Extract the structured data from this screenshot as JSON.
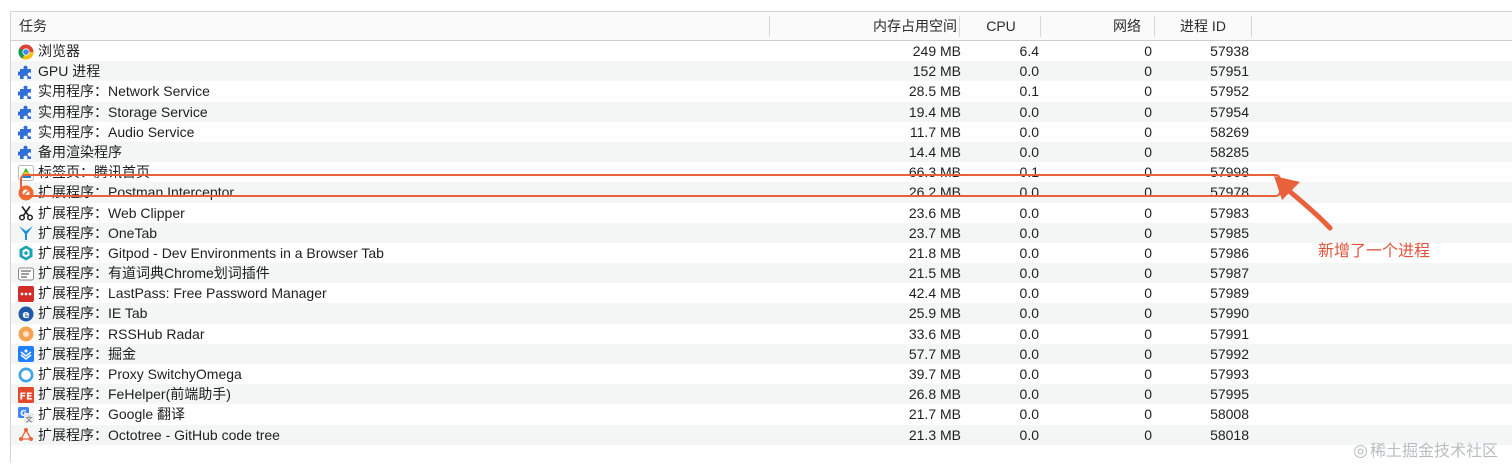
{
  "header": {
    "task": "任务",
    "memory": "内存占用空间",
    "cpu": "CPU",
    "network": "网络",
    "pid": "进程 ID"
  },
  "rows": [
    {
      "name": "浏览器",
      "mem": "249 MB",
      "cpu": "6.4",
      "net": "0",
      "pid": "57938",
      "icon": "chrome-icon"
    },
    {
      "name": "GPU 进程",
      "mem": "152 MB",
      "cpu": "0.0",
      "net": "0",
      "pid": "57951",
      "icon": "puzzle-icon"
    },
    {
      "name": "实用程序：Network Service",
      "mem": "28.5 MB",
      "cpu": "0.1",
      "net": "0",
      "pid": "57952",
      "icon": "puzzle-icon"
    },
    {
      "name": "实用程序：Storage Service",
      "mem": "19.4 MB",
      "cpu": "0.0",
      "net": "0",
      "pid": "57954",
      "icon": "puzzle-icon"
    },
    {
      "name": "实用程序：Audio Service",
      "mem": "11.7 MB",
      "cpu": "0.0",
      "net": "0",
      "pid": "58269",
      "icon": "puzzle-icon"
    },
    {
      "name": "备用渲染程序",
      "mem": "14.4 MB",
      "cpu": "0.0",
      "net": "0",
      "pid": "58285",
      "icon": "puzzle-icon"
    },
    {
      "name": "标签页：腾讯首页",
      "mem": "66.3 MB",
      "cpu": "0.1",
      "net": "0",
      "pid": "57998",
      "icon": "qq-tab-icon"
    },
    {
      "name": "扩展程序：Postman Interceptor",
      "mem": "26.2 MB",
      "cpu": "0.0",
      "net": "0",
      "pid": "57978",
      "icon": "postman-icon"
    },
    {
      "name": "扩展程序：Web Clipper",
      "mem": "23.6 MB",
      "cpu": "0.0",
      "net": "0",
      "pid": "57983",
      "icon": "scissors-icon"
    },
    {
      "name": "扩展程序：OneTab",
      "mem": "23.7 MB",
      "cpu": "0.0",
      "net": "0",
      "pid": "57985",
      "icon": "funnel-icon"
    },
    {
      "name": "扩展程序：Gitpod - Dev Environments in a Browser Tab",
      "mem": "21.8 MB",
      "cpu": "0.0",
      "net": "0",
      "pid": "57986",
      "icon": "gitpod-icon"
    },
    {
      "name": "扩展程序：有道词典Chrome划词插件",
      "mem": "21.5 MB",
      "cpu": "0.0",
      "net": "0",
      "pid": "57987",
      "icon": "youdao-icon"
    },
    {
      "name": "扩展程序：LastPass: Free Password Manager",
      "mem": "42.4 MB",
      "cpu": "0.0",
      "net": "0",
      "pid": "57989",
      "icon": "lastpass-icon"
    },
    {
      "name": "扩展程序：IE Tab",
      "mem": "25.9 MB",
      "cpu": "0.0",
      "net": "0",
      "pid": "57990",
      "icon": "ie-tab-icon"
    },
    {
      "name": "扩展程序：RSSHub Radar",
      "mem": "33.6 MB",
      "cpu": "0.0",
      "net": "0",
      "pid": "57991",
      "icon": "rsshub-icon"
    },
    {
      "name": "扩展程序：掘金",
      "mem": "57.7 MB",
      "cpu": "0.0",
      "net": "0",
      "pid": "57992",
      "icon": "juejin-icon"
    },
    {
      "name": "扩展程序：Proxy SwitchyOmega",
      "mem": "39.7 MB",
      "cpu": "0.0",
      "net": "0",
      "pid": "57993",
      "icon": "switchyomega-icon"
    },
    {
      "name": "扩展程序：FeHelper(前端助手)",
      "mem": "26.8 MB",
      "cpu": "0.0",
      "net": "0",
      "pid": "57995",
      "icon": "fehelper-icon"
    },
    {
      "name": "扩展程序：Google 翻译",
      "mem": "21.7 MB",
      "cpu": "0.0",
      "net": "0",
      "pid": "58008",
      "icon": "google-translate-icon"
    },
    {
      "name": "扩展程序：Octotree - GitHub code tree",
      "mem": "21.3 MB",
      "cpu": "0.0",
      "net": "0",
      "pid": "58018",
      "icon": "octotree-icon"
    }
  ],
  "annotation": {
    "text": "新增了一个进程",
    "color": "#e8613a"
  },
  "watermark": {
    "text": "稀土掘金技术社区"
  },
  "colors": {
    "row_alt": "#f4f5f5",
    "highlight": "#e8613a",
    "puzzle": "#2f6fd6"
  }
}
